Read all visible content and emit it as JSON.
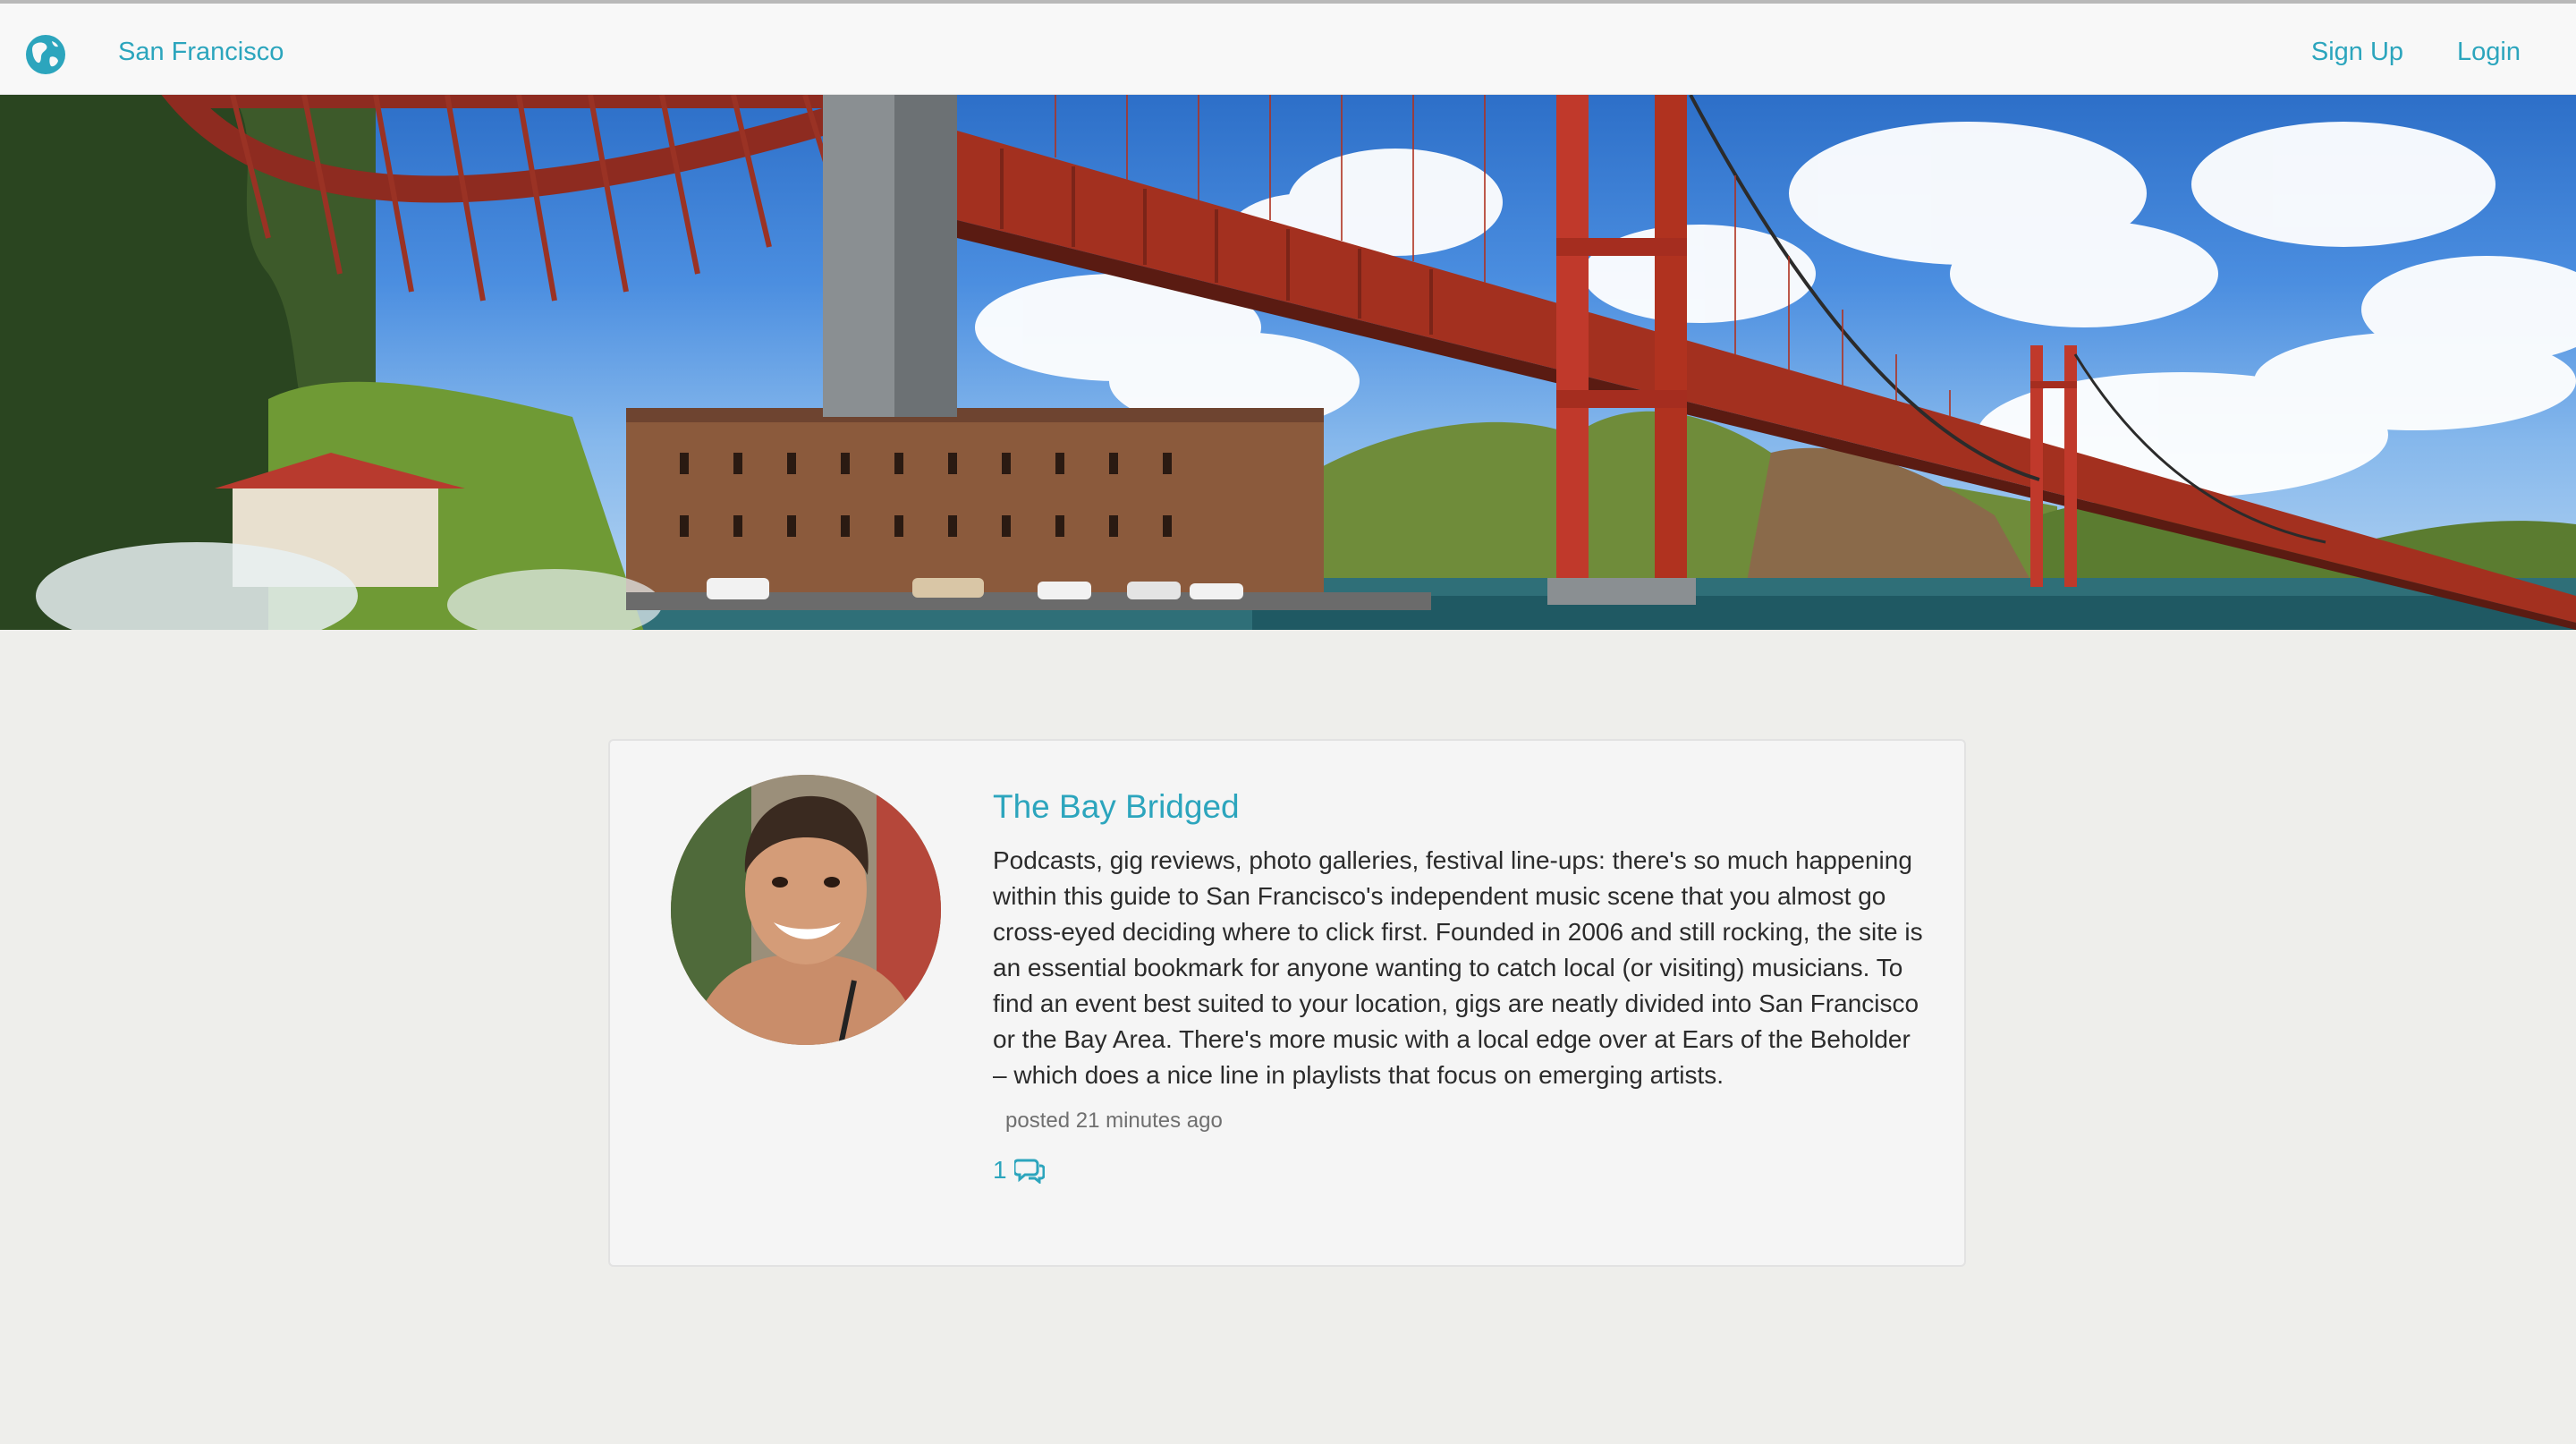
{
  "navbar": {
    "brand_icon": "globe-icon",
    "brand_label": "San Francisco",
    "signup_label": "Sign Up",
    "login_label": "Login"
  },
  "hero": {
    "image": "golden-gate-bridge-photo"
  },
  "post": {
    "title": "The Bay Bridged",
    "body": "Podcasts, gig reviews, photo galleries, festival line-ups: there's so much happening within this guide to San Francisco's independent music scene that you almost go cross-eyed deciding where to click first. Founded in 2006 and still rocking, the site is an essential bookmark for anyone wanting to catch local (or visiting) musicians. To find an event best suited to your location, gigs are neatly divided into San Francisco or the Bay Area. There's more music with a local edge over at Ears of the Beholder – which does a nice line in playlists that focus on emerging artists.",
    "meta": "posted 21 minutes ago",
    "comment_count": "1",
    "comment_icon": "comments-icon"
  },
  "colors": {
    "accent": "#2ca5bd",
    "background": "#eeeeeb",
    "navbar": "#f8f8f8",
    "card": "#f5f5f5"
  }
}
